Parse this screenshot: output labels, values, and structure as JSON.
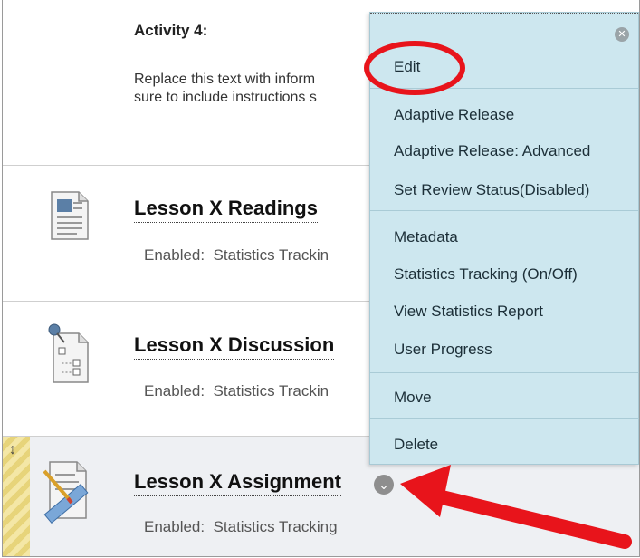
{
  "activity": {
    "title": "Activity 4:",
    "text": "Replace this text with inform\nsure to include instructions s"
  },
  "items": [
    {
      "title": "Lesson X Readings",
      "meta": "Enabled:  Statistics Trackin",
      "icon": "document-icon"
    },
    {
      "title": "Lesson X Discussion",
      "meta": "Enabled:  Statistics Trackin",
      "icon": "discussion-icon"
    },
    {
      "title": "Lesson X Assignment",
      "meta": "Enabled:  Statistics Tracking",
      "icon": "assignment-icon"
    }
  ],
  "menu": {
    "groups": [
      [
        "Edit"
      ],
      [
        "Adaptive Release",
        "Adaptive Release: Advanced",
        "Set Review Status(Disabled)"
      ],
      [
        "Metadata",
        "Statistics Tracking (On/Off)",
        "View Statistics Report",
        "User Progress"
      ],
      [
        "Move"
      ],
      [
        "Delete"
      ]
    ]
  },
  "colors": {
    "menu_bg": "#cde7ef",
    "annotation": "#e8141b",
    "drag_handle": "#f4e7a6"
  },
  "icons": [
    "close-icon",
    "chevron-down-icon",
    "drag-arrows-icon"
  ]
}
